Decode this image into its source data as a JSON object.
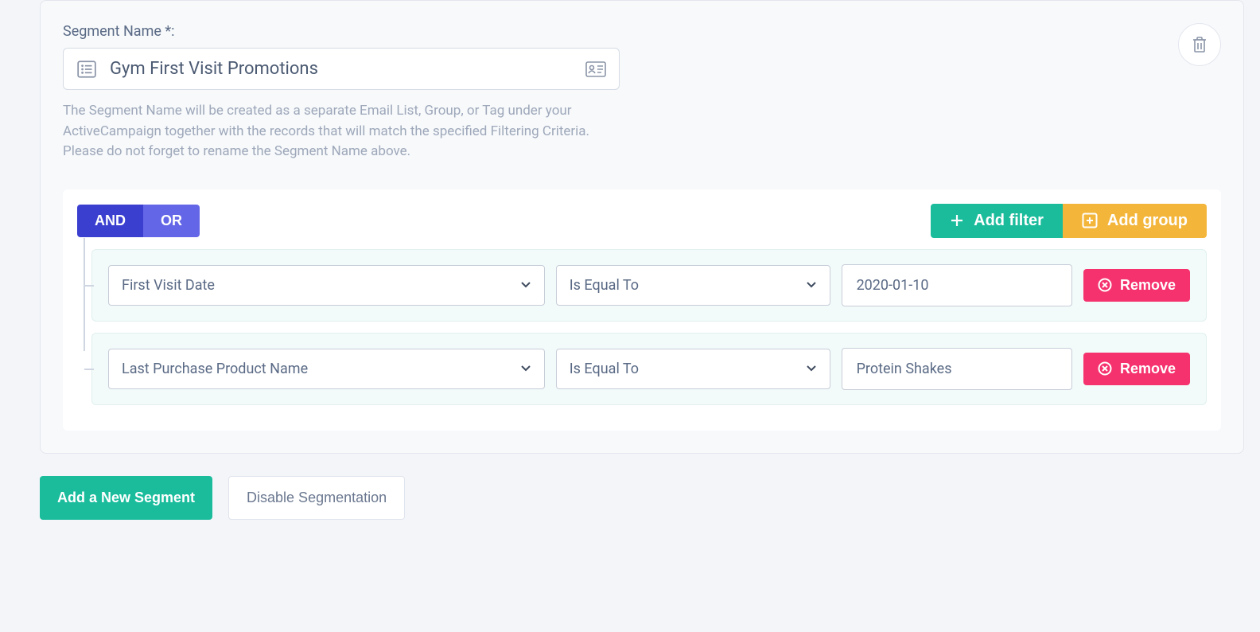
{
  "segment": {
    "label": "Segment Name *:",
    "value": "Gym First Visit Promotions",
    "help_text": "The Segment Name will be created as a separate Email List, Group, or Tag under your ActiveCampaign together with the records that will match the specified Filtering Criteria. Please do not forget to rename the Segment Name above."
  },
  "logic": {
    "and_label": "AND",
    "or_label": "OR"
  },
  "actions": {
    "add_filter_label": "Add filter",
    "add_group_label": "Add group",
    "remove_label": "Remove"
  },
  "filters": [
    {
      "field": "First Visit Date",
      "operator": "Is Equal To",
      "value": "2020-01-10"
    },
    {
      "field": "Last Purchase Product Name",
      "operator": "Is Equal To",
      "value": "Protein Shakes"
    }
  ],
  "bottom": {
    "add_segment_label": "Add a New Segment",
    "disable_seg_label": "Disable Segmentation"
  }
}
